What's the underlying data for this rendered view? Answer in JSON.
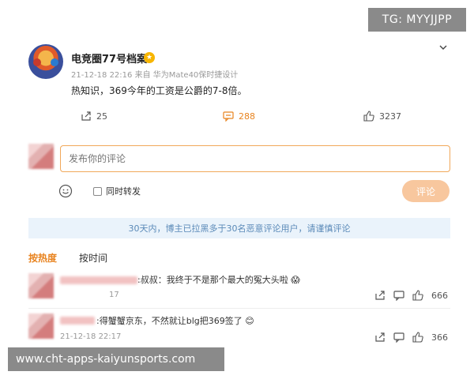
{
  "watermark": {
    "top": "TG: MYYJJPP",
    "bottom": "www.cht-apps-kaiyunsports.com"
  },
  "post": {
    "username": "电竞圈77号档案",
    "meta": "21-12-18 22:16  来自 华为Mate40保时捷设计",
    "text": "热知识，369今年的工资是公爵的7-8倍。",
    "shares": "25",
    "comments": "288",
    "likes": "3237"
  },
  "composer": {
    "placeholder": "发布你的评论",
    "repost_label": "同时转发",
    "submit_label": "评论"
  },
  "notice": "30天内，博主已拉黑多于30名恶意评论用户，请谨慎评论",
  "tabs": {
    "hot": "按热度",
    "time": "按时间"
  },
  "comments": [
    {
      "text": ":叔叔：我终于不是那个最大的冤大头啦",
      "time": "17",
      "likes": "666"
    },
    {
      "text": ":得蟹蟹京东，不然就让blg把369签了",
      "time": "21-12-18 22:17",
      "likes": "366"
    }
  ],
  "colors": {
    "accent": "#e8831f",
    "notice_bg": "#eaf3fb",
    "notice_text": "#5b8ab8",
    "submit_bg": "#f8c79e"
  },
  "icons": {
    "share": "share-icon",
    "comment": "comment-icon",
    "like": "like-icon",
    "emoji": "emoji-icon",
    "chevron": "chevron-down-icon"
  }
}
